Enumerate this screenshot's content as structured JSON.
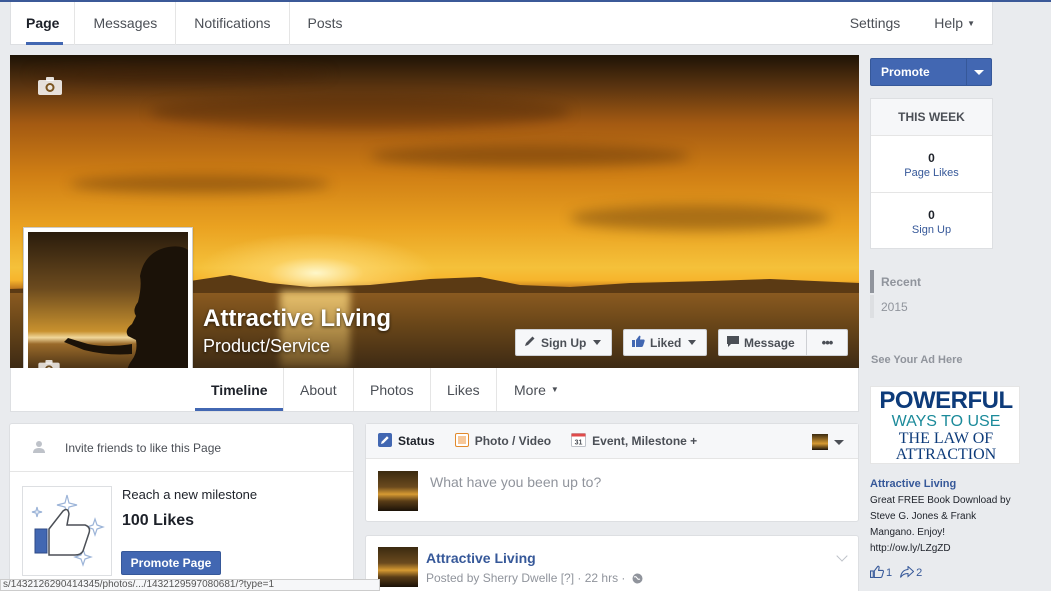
{
  "topnav": {
    "tabs": [
      "Page",
      "Messages",
      "Notifications",
      "Posts"
    ],
    "settings": "Settings",
    "help": "Help"
  },
  "cover": {
    "page_name": "Attractive Living",
    "category": "Product/Service",
    "buttons": {
      "sign_up": "Sign Up",
      "liked": "Liked",
      "message": "Message",
      "more": "•••"
    }
  },
  "subnav": {
    "tabs": [
      "Timeline",
      "About",
      "Photos",
      "Likes",
      "More"
    ]
  },
  "right": {
    "promote": "Promote",
    "this_week": "THIS WEEK",
    "page_likes_num": "0",
    "page_likes_label": "Page Likes",
    "sign_up_num": "0",
    "sign_up_label": "Sign Up",
    "years": [
      "Recent",
      "2015"
    ],
    "see_ad": "See Your Ad Here",
    "ad": {
      "image_lines": [
        "POWERFUL",
        "WAYS TO USE",
        "THE LAW OF",
        "ATTRACTION"
      ],
      "title": "Attractive Living",
      "body": "Great FREE Book Download by Steve G. Jones & Frank Mangano. Enjoy! http://ow.ly/LZgZD",
      "likes": "1",
      "shares": "2"
    }
  },
  "left": {
    "invite": "Invite friends to like this Page",
    "milestone_title": "Reach a new milestone",
    "milestone_likes": "100 Likes",
    "promote_page": "Promote Page"
  },
  "composer": {
    "tabs": [
      "Status",
      "Photo / Video",
      "Event, Milestone +"
    ],
    "placeholder": "What have you been up to?"
  },
  "post": {
    "name": "Attractive Living",
    "meta": "Posted by Sherry Dwelle [?] · 22 hrs ·"
  },
  "statusbar": "s/1432126290414345/photos/.../1432129597080681/?type=1",
  "colors": {
    "brand_blue": "#4267b2",
    "link_blue": "#365899",
    "page_bg": "#e9ebee"
  }
}
